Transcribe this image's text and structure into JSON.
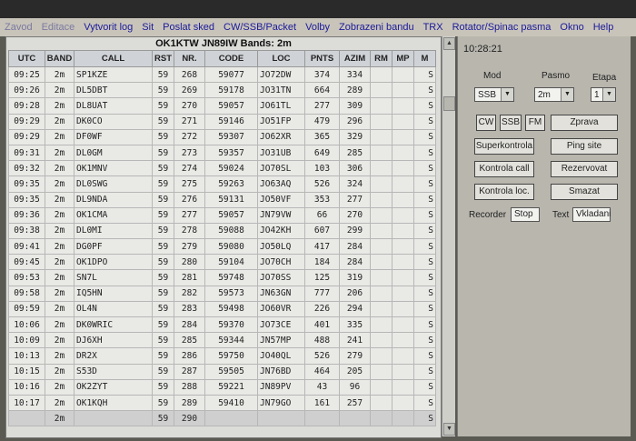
{
  "menu": [
    "Zavod",
    "Editace",
    "Vytvorit log",
    "Sit",
    "Poslat sked",
    "CW/SSB/Packet",
    "Volby",
    "Zobrazeni bandu",
    "TRX",
    "Rotator/Spinac pasma",
    "Okno",
    "Help"
  ],
  "log": {
    "title": "OK1KTW  JN89IW  Bands:  2m",
    "headers": [
      "UTC",
      "BAND",
      "CALL",
      "RST",
      "NR.",
      "CODE",
      "LOC",
      "PNTS",
      "AZIM",
      "RM",
      "MP",
      "M"
    ],
    "rows": [
      [
        "09:25",
        "2m",
        "SP1KZE",
        "59",
        "268",
        "59077",
        "JO72DW",
        "374",
        "334",
        "",
        "",
        "S"
      ],
      [
        "09:26",
        "2m",
        "DL5DBT",
        "59",
        "269",
        "59178",
        "JO31TN",
        "664",
        "289",
        "",
        "",
        "S"
      ],
      [
        "09:28",
        "2m",
        "DL8UAT",
        "59",
        "270",
        "59057",
        "JO61TL",
        "277",
        "309",
        "",
        "",
        "S"
      ],
      [
        "09:29",
        "2m",
        "DK0CO",
        "59",
        "271",
        "59146",
        "JO51FP",
        "479",
        "296",
        "",
        "",
        "S"
      ],
      [
        "09:29",
        "2m",
        "DF0WF",
        "59",
        "272",
        "59307",
        "JO62XR",
        "365",
        "329",
        "",
        "",
        "S"
      ],
      [
        "09:31",
        "2m",
        "DL0GM",
        "59",
        "273",
        "59357",
        "JO31UB",
        "649",
        "285",
        "",
        "",
        "S"
      ],
      [
        "09:32",
        "2m",
        "OK1MNV",
        "59",
        "274",
        "59024",
        "JO70SL",
        "103",
        "306",
        "",
        "",
        "S"
      ],
      [
        "09:35",
        "2m",
        "DL0SWG",
        "59",
        "275",
        "59263",
        "JO63AQ",
        "526",
        "324",
        "",
        "",
        "S"
      ],
      [
        "09:35",
        "2m",
        "DL9NDA",
        "59",
        "276",
        "59131",
        "JO50VF",
        "353",
        "277",
        "",
        "",
        "S"
      ],
      [
        "09:36",
        "2m",
        "OK1CMA",
        "59",
        "277",
        "59057",
        "JN79VW",
        "66",
        "270",
        "",
        "",
        "S"
      ],
      [
        "09:38",
        "2m",
        "DL0MI",
        "59",
        "278",
        "59088",
        "JO42KH",
        "607",
        "299",
        "",
        "",
        "S"
      ],
      [
        "09:41",
        "2m",
        "DG0PF",
        "59",
        "279",
        "59080",
        "JO50LQ",
        "417",
        "284",
        "",
        "",
        "S"
      ],
      [
        "09:45",
        "2m",
        "OK1DPO",
        "59",
        "280",
        "59104",
        "JO70CH",
        "184",
        "284",
        "",
        "",
        "S"
      ],
      [
        "09:53",
        "2m",
        "SN7L",
        "59",
        "281",
        "59748",
        "JO70SS",
        "125",
        "319",
        "",
        "",
        "S"
      ],
      [
        "09:58",
        "2m",
        "IQ5HN",
        "59",
        "282",
        "59573",
        "JN63GN",
        "777",
        "206",
        "",
        "",
        "S"
      ],
      [
        "09:59",
        "2m",
        "OL4N",
        "59",
        "283",
        "59498",
        "JO60VR",
        "226",
        "294",
        "",
        "",
        "S"
      ],
      [
        "10:06",
        "2m",
        "DK0WRIC",
        "59",
        "284",
        "59370",
        "JO73CE",
        "401",
        "335",
        "",
        "",
        "S"
      ],
      [
        "10:09",
        "2m",
        "DJ6XH",
        "59",
        "285",
        "59344",
        "JN57MP",
        "488",
        "241",
        "",
        "",
        "S"
      ],
      [
        "10:13",
        "2m",
        "DR2X",
        "59",
        "286",
        "59750",
        "JO40QL",
        "526",
        "279",
        "",
        "",
        "S"
      ],
      [
        "10:15",
        "2m",
        "S53D",
        "59",
        "287",
        "59505",
        "JN76BD",
        "464",
        "205",
        "",
        "",
        "S"
      ],
      [
        "10:16",
        "2m",
        "OK2ZYT",
        "59",
        "288",
        "59221",
        "JN89PV",
        "43",
        "96",
        "",
        "",
        "S"
      ],
      [
        "10:17",
        "2m",
        "OK1KQH",
        "59",
        "289",
        "59410",
        "JN79GO",
        "161",
        "257",
        "",
        "",
        "S"
      ],
      [
        "",
        "2m",
        "",
        "59",
        "290",
        "",
        "",
        "",
        "",
        "",
        "",
        "S"
      ]
    ]
  },
  "control": {
    "clock": "10:28:21",
    "mod_label": "Mod",
    "pasmo_label": "Pasmo",
    "etapa_label": "Etapa",
    "mod_value": "SSB",
    "pasmo_value": "2m",
    "etapa_value": "1",
    "btn_cw": "CW",
    "btn_ssb": "SSB",
    "btn_fm": "FM",
    "btn_zprava": "Zprava",
    "btn_superkontrola": "Superkontrola",
    "btn_ping": "Ping site",
    "btn_kontrola_call": "Kontrola call",
    "btn_rezervovat": "Rezervovat",
    "btn_kontrola_loc": "Kontrola loc.",
    "btn_smazat": "Smazat",
    "recorder_label": "Recorder",
    "recorder_value": "Stop",
    "text_label": "Text",
    "text_value": "Vkladani"
  }
}
